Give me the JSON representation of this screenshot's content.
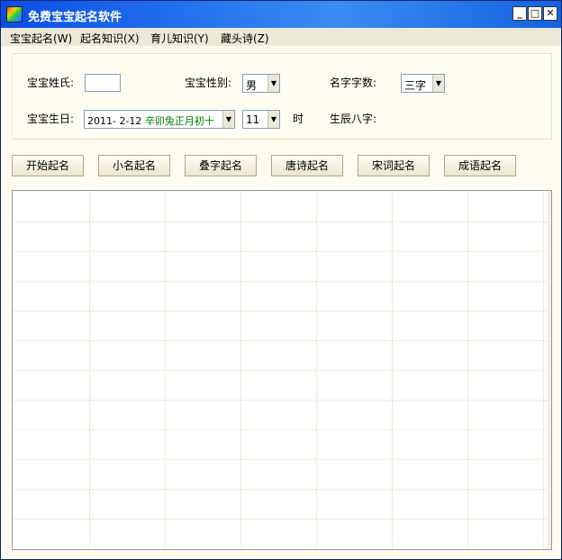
{
  "window": {
    "title": "免费宝宝起名软件"
  },
  "title_buttons": {
    "minimize": "_",
    "maximize": "□",
    "close": "✕"
  },
  "menu": [
    {
      "label": "宝宝起名(W)"
    },
    {
      "label": "起名知识(X)"
    },
    {
      "label": "育儿知识(Y)"
    },
    {
      "label": "藏头诗(Z)"
    }
  ],
  "form": {
    "surname_label": "宝宝姓氏:",
    "surname_value": "",
    "gender_label": "宝宝性别:",
    "gender_value": "男",
    "name_length_label": "名字字数:",
    "name_length_value": "三字",
    "birthday_label": "宝宝生日:",
    "birthday_date": "2011- 2-12",
    "birthday_lunar": "辛卯兔正月初十",
    "hour_value": "11",
    "hour_unit": "时",
    "bazi_label": "生辰八字:",
    "bazi_value": ""
  },
  "buttons": [
    {
      "label": "开始起名"
    },
    {
      "label": "小名起名"
    },
    {
      "label": "叠字起名"
    },
    {
      "label": "唐诗起名"
    },
    {
      "label": "宋词起名"
    },
    {
      "label": "成语起名"
    }
  ],
  "icons": {
    "app": "app-icon",
    "dropdown": "chevron-down-icon"
  }
}
